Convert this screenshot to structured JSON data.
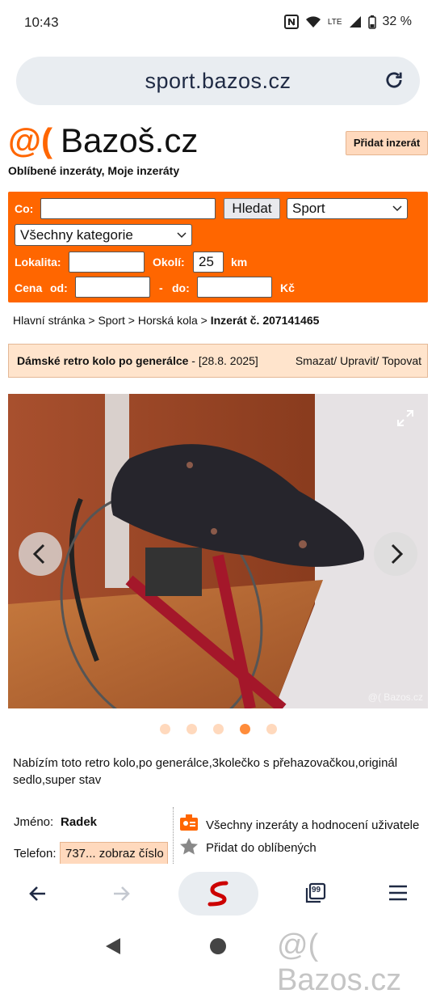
{
  "status_bar": {
    "time": "10:43",
    "battery": "32 %",
    "network": "LTE"
  },
  "browser": {
    "url": "sport.bazos.cz"
  },
  "site": {
    "logo_mark": "@(",
    "logo_name": "Bazoš.cz",
    "post_button": "Přidat inzerát",
    "fav_links": "Oblíbené inzeráty, Moje inzeráty"
  },
  "search": {
    "co_label": "Co:",
    "co_value": "",
    "search_button": "Hledat",
    "category_selected": "Sport",
    "subcategory_selected": "Všechny kategorie",
    "lokalita_label": "Lokalita:",
    "lokalita_value": "",
    "okoli_label": "Okolí:",
    "okoli_value": "25",
    "okoli_unit": "km",
    "cena_label": "Cena",
    "od_label": "od:",
    "do_label": "do:",
    "dash": "-",
    "currency": "Kč"
  },
  "breadcrumb": {
    "path": "Hlavní stránka > Sport > Horská kola > ",
    "current": "Inzerát č. 207141465"
  },
  "listing": {
    "title": "Dámské retro kolo po generálce",
    "date": " - [28.8. 2025]",
    "actions": "Smazat/ Upravit/ Topovat",
    "image_watermark": "@( Bazos.cz",
    "photo_count": 5,
    "active_photo": 4,
    "description": "Nabízím toto retro kolo,po generálce,3kolečko s přehazovačkou,originál sedlo,super stav"
  },
  "seller": {
    "name_label": "Jméno:",
    "name_value": "Radek",
    "phone_label": "Telefon:",
    "phone_value": "737... zobraz číslo",
    "all_ads_link": "Všechny inzeráty a hodnocení uživatele",
    "add_fav_link": "Přidat do oblíbených"
  },
  "bottom_nav": {
    "tabs_count": "99"
  },
  "overlay_watermark": "@( Bazos.cz"
}
